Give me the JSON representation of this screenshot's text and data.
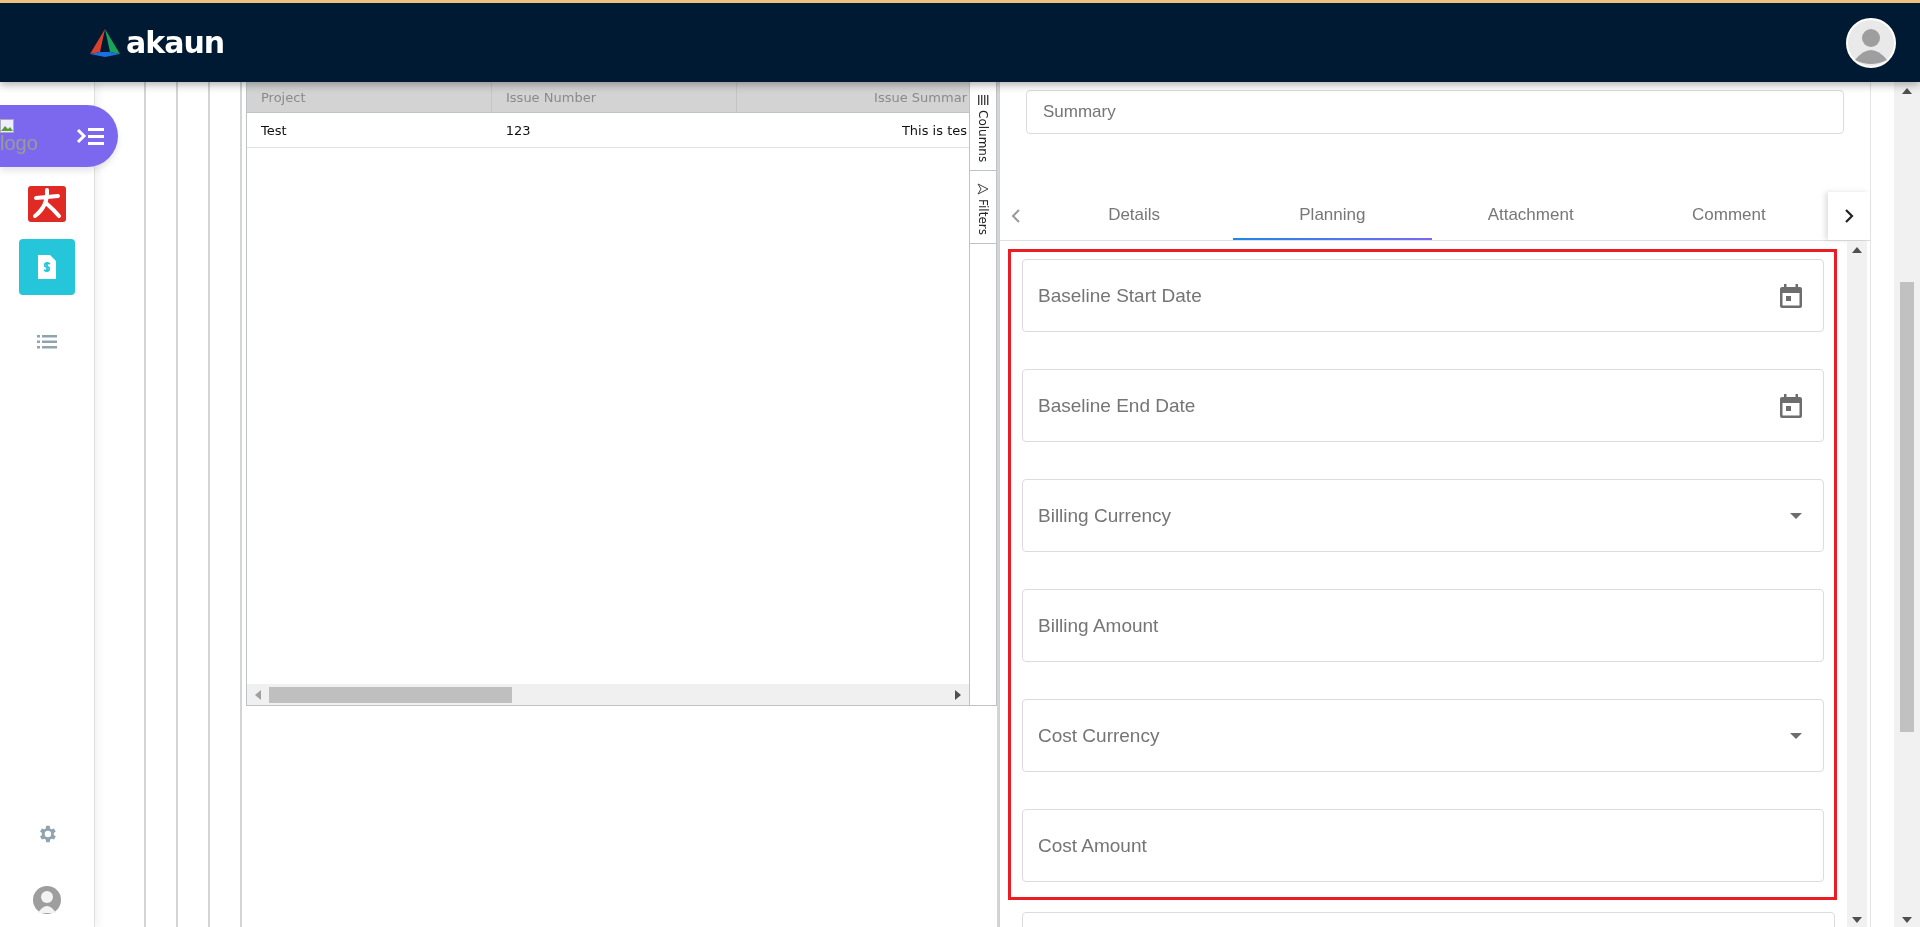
{
  "header": {
    "brand": "akaun"
  },
  "sidebar": {
    "logo_alt": "logo",
    "apps": [
      {
        "kind": "red-app",
        "selected": false
      },
      {
        "kind": "invoice",
        "selected": true
      },
      {
        "kind": "list",
        "selected": false
      }
    ]
  },
  "grid": {
    "columns": [
      "Project",
      "Issue Number",
      "Issue Summar"
    ],
    "rows": [
      [
        "Test",
        "123",
        "This is tes"
      ]
    ],
    "side_buttons": [
      {
        "kind": "columns",
        "label": "Columns"
      },
      {
        "kind": "filters",
        "label": "Filters"
      }
    ]
  },
  "summary": {
    "placeholder": "Summary"
  },
  "tabs": [
    {
      "label": "Details",
      "selected": false
    },
    {
      "label": "Planning",
      "selected": true
    },
    {
      "label": "Attachment",
      "selected": false
    },
    {
      "label": "Comment",
      "selected": false
    }
  ],
  "fields": [
    {
      "kind": "date",
      "placeholder": "Baseline Start Date"
    },
    {
      "kind": "date",
      "placeholder": "Baseline End Date"
    },
    {
      "kind": "select",
      "placeholder": "Billing Currency"
    },
    {
      "kind": "text",
      "placeholder": "Billing Amount"
    },
    {
      "kind": "select",
      "placeholder": "Cost Currency"
    },
    {
      "kind": "text",
      "placeholder": "Cost Amount"
    }
  ]
}
